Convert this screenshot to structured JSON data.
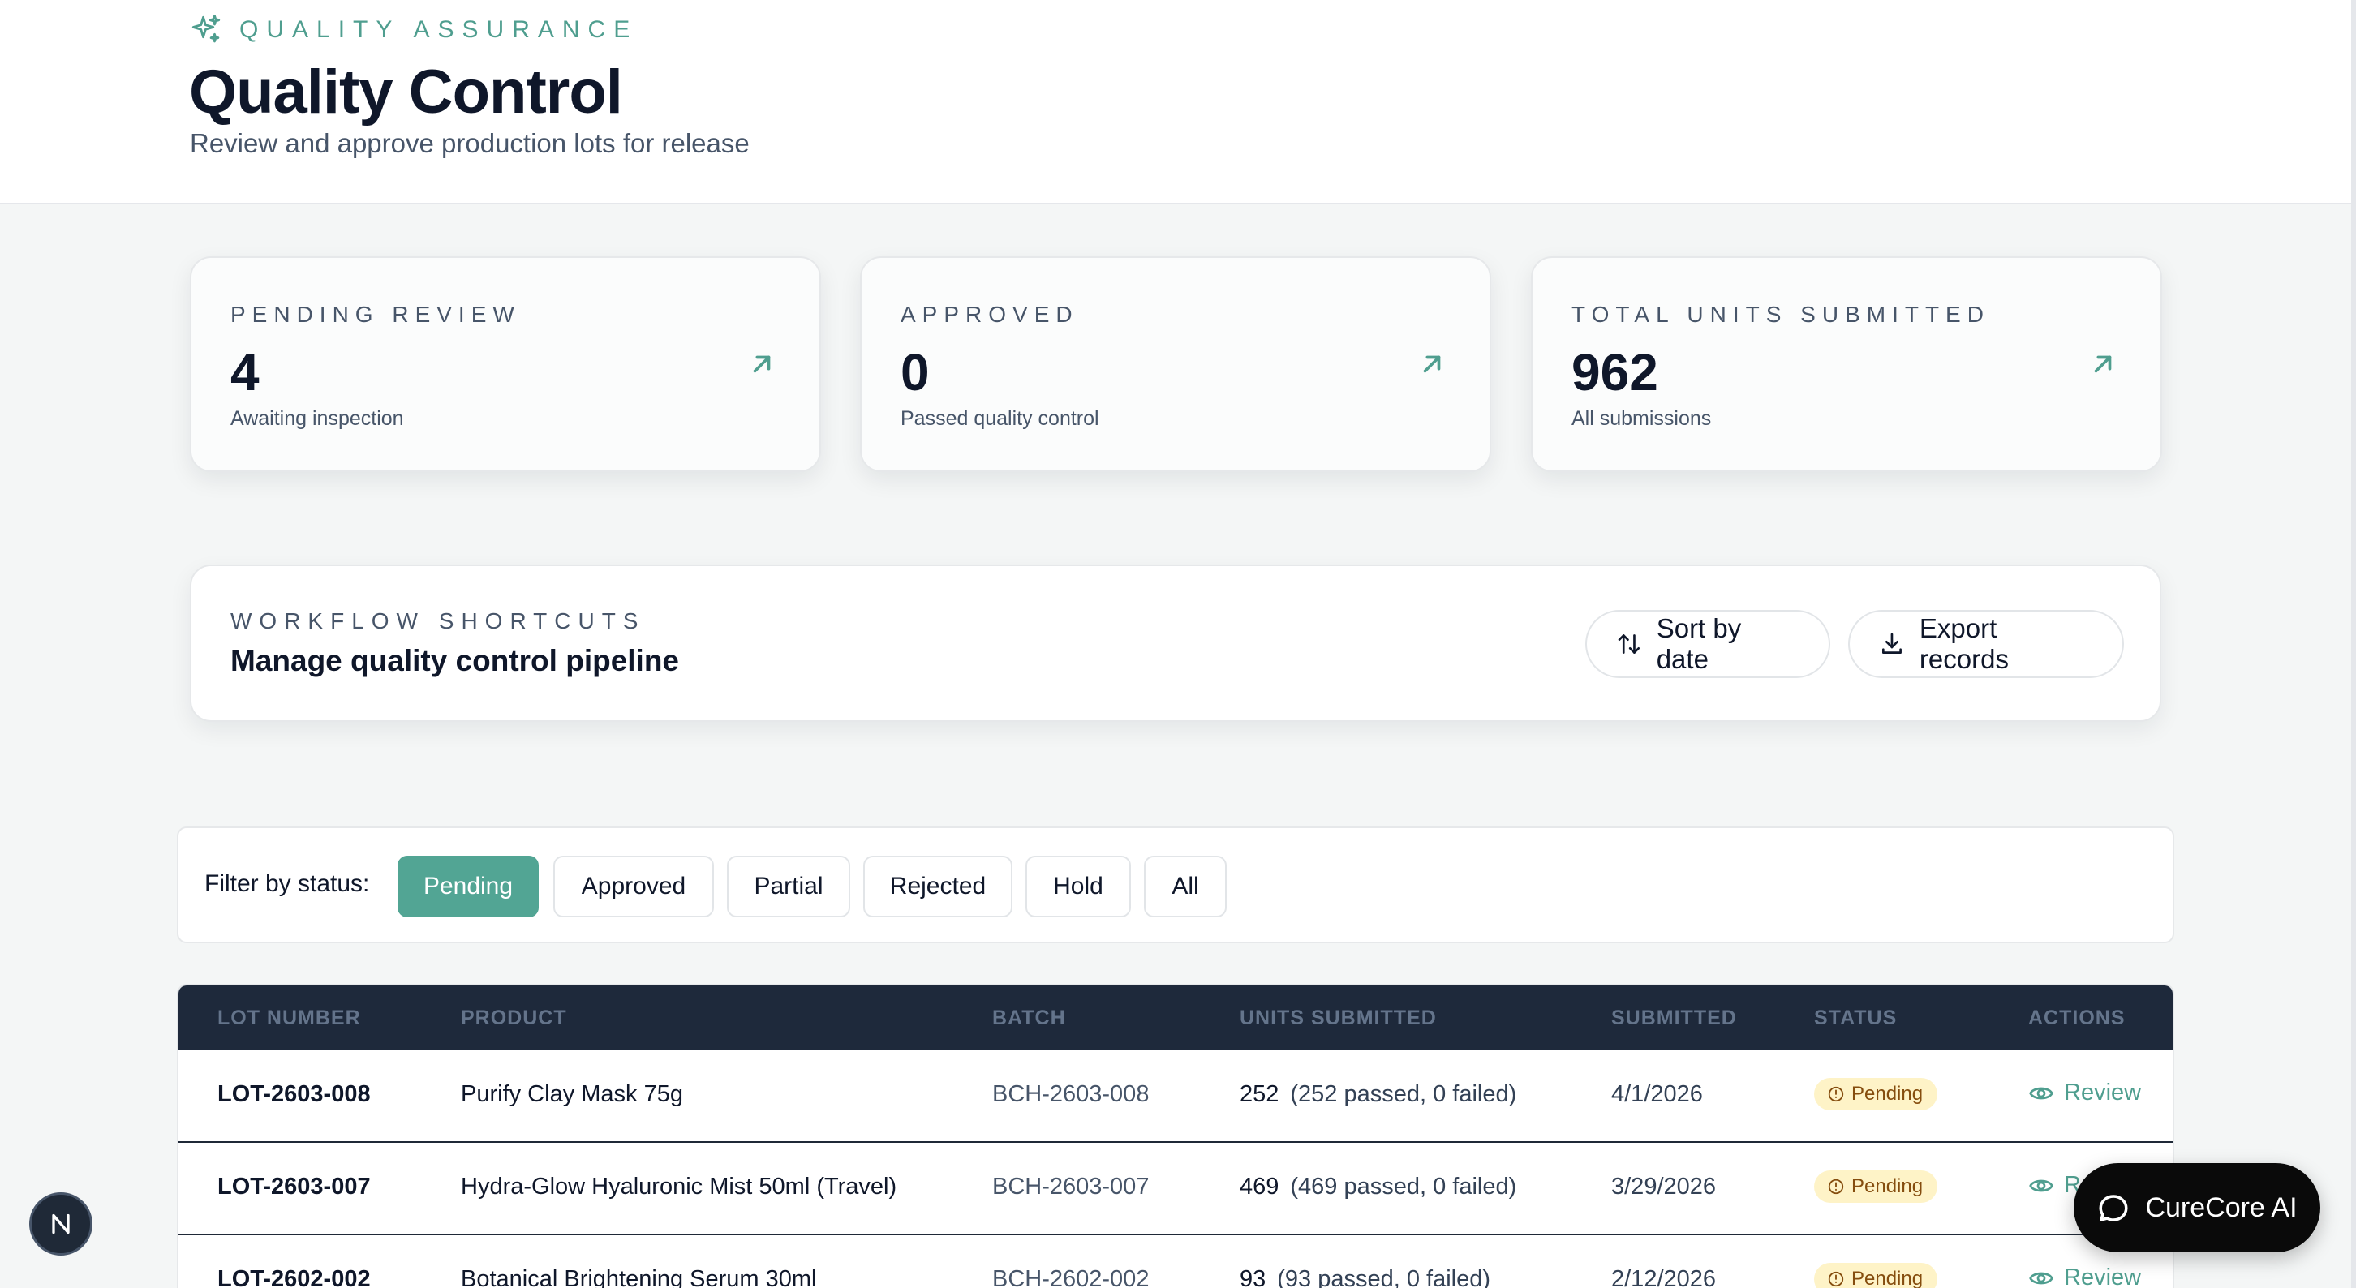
{
  "header": {
    "eyebrow": "QUALITY ASSURANCE",
    "title": "Quality Control",
    "subtitle": "Review and approve production lots for release"
  },
  "stats": [
    {
      "label": "PENDING REVIEW",
      "value": "4",
      "note": "Awaiting inspection"
    },
    {
      "label": "APPROVED",
      "value": "0",
      "note": "Passed quality control"
    },
    {
      "label": "TOTAL UNITS SUBMITTED",
      "value": "962",
      "note": "All submissions"
    }
  ],
  "workflow": {
    "label": "WORKFLOW SHORTCUTS",
    "title": "Manage quality control pipeline",
    "sort_label": "Sort by date",
    "export_label": "Export records"
  },
  "filter": {
    "label": "Filter by status:",
    "chips": [
      "Pending",
      "Approved",
      "Partial",
      "Rejected",
      "Hold",
      "All"
    ],
    "active": "Pending"
  },
  "table": {
    "columns": [
      "LOT NUMBER",
      "PRODUCT",
      "BATCH",
      "UNITS SUBMITTED",
      "SUBMITTED",
      "STATUS",
      "ACTIONS"
    ],
    "rows": [
      {
        "lot": "LOT-2603-008",
        "product": "Purify Clay Mask 75g",
        "batch": "BCH-2603-008",
        "units": "252",
        "units_detail": "(252 passed, 0 failed)",
        "submitted": "4/1/2026",
        "status": "Pending",
        "action": "Review"
      },
      {
        "lot": "LOT-2603-007",
        "product": "Hydra-Glow Hyaluronic Mist 50ml (Travel)",
        "batch": "BCH-2603-007",
        "units": "469",
        "units_detail": "(469 passed, 0 failed)",
        "submitted": "3/29/2026",
        "status": "Pending",
        "action": "Review"
      },
      {
        "lot": "LOT-2602-002",
        "product": "Botanical Brightening Serum 30ml",
        "batch": "BCH-2602-002",
        "units": "93",
        "units_detail": "(93 passed, 0 failed)",
        "submitted": "2/12/2026",
        "status": "Pending",
        "action": "Review"
      }
    ]
  },
  "assistant": {
    "label": "CureCore AI"
  },
  "colors": {
    "accent": "#52a594",
    "table_header": "#1e293b",
    "pending_bg": "#fef3c7"
  }
}
